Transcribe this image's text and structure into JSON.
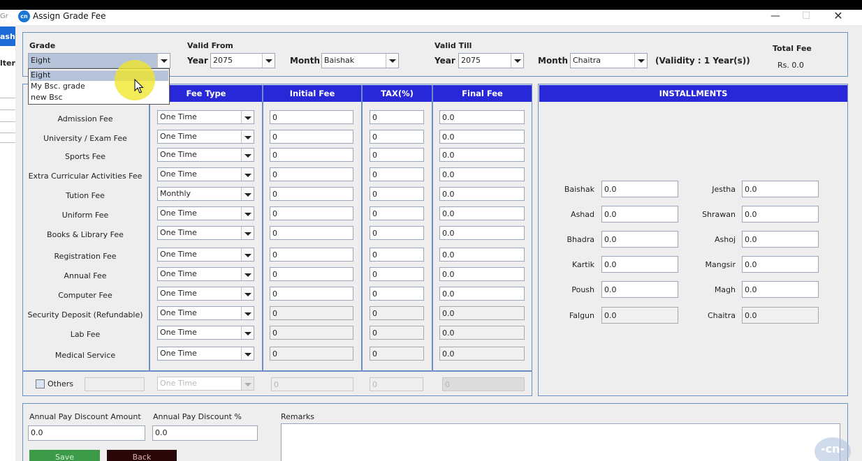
{
  "background_app": {
    "title_fragment": "Gr",
    "nav_fragment": "ashb",
    "filter_fragment": "lter"
  },
  "window": {
    "title": "Assign Grade Fee",
    "logo_text": "cn",
    "minimize_glyph": "—",
    "maximize_glyph": "☐",
    "close_glyph": "✕"
  },
  "header": {
    "grade_label": "Grade",
    "grade_value": "Eight",
    "grade_options": [
      "Eight",
      "My Bsc. grade",
      "new Bsc"
    ],
    "valid_from_label": "Valid From",
    "valid_from_year_label": "Year",
    "valid_from_year": "2075",
    "valid_from_month_label": "Month",
    "valid_from_month": "Baishak",
    "valid_till_label": "Valid Till",
    "valid_till_year_label": "Year",
    "valid_till_year": "2075",
    "valid_till_month_label": "Month",
    "valid_till_month": "Chaitra",
    "validity_text": "(Validity : 1 Year(s))",
    "total_fee_label": "Total Fee",
    "total_fee_value": "Rs. 0.0"
  },
  "fee_table": {
    "columns": [
      "Fee Type",
      "Initial Fee",
      "TAX(%)",
      "Final Fee"
    ],
    "rows": [
      {
        "name": "Admission Fee",
        "type": "One Time",
        "initial": "0",
        "tax": "0",
        "final": "0.0"
      },
      {
        "name": "University / Exam Fee",
        "type": "One Time",
        "initial": "0",
        "tax": "0",
        "final": "0.0"
      },
      {
        "name": "Sports Fee",
        "type": "One Time",
        "initial": "0",
        "tax": "0",
        "final": "0.0"
      },
      {
        "name": "Extra Curricular Activities Fee",
        "type": "One Time",
        "initial": "0",
        "tax": "0",
        "final": "0.0"
      },
      {
        "name": "Tution Fee",
        "type": "Monthly",
        "initial": "0",
        "tax": "0",
        "final": "0.0"
      },
      {
        "name": "Uniform Fee",
        "type": "One Time",
        "initial": "0",
        "tax": "0",
        "final": "0.0"
      },
      {
        "name": "Books & Library Fee",
        "type": "One Time",
        "initial": "0",
        "tax": "0",
        "final": "0.0"
      },
      {
        "name": "Registration Fee",
        "type": "One Time",
        "initial": "0",
        "tax": "0",
        "final": "0.0"
      },
      {
        "name": "Annual Fee",
        "type": "One Time",
        "initial": "0",
        "tax": "0",
        "final": "0.0"
      },
      {
        "name": "Computer Fee",
        "type": "One Time",
        "initial": "0",
        "tax": "0",
        "final": "0.0"
      },
      {
        "name": "Security Deposit (Refundable)",
        "type": "One Time",
        "initial": "0",
        "tax": "0",
        "final": "0.0"
      },
      {
        "name": "Lab Fee",
        "type": "One Time",
        "initial": "0",
        "tax": "0",
        "final": "0.0"
      },
      {
        "name": "Medical Service",
        "type": "One Time",
        "initial": "0",
        "tax": "0",
        "final": "0.0"
      }
    ],
    "others": {
      "label": "Others",
      "type": "One Time",
      "initial": "0",
      "tax": "0",
      "final": "0"
    }
  },
  "installments": {
    "title": "INSTALLMENTS",
    "months": [
      {
        "name": "Baishak",
        "value": "0.0"
      },
      {
        "name": "Jestha",
        "value": "0.0"
      },
      {
        "name": "Ashad",
        "value": "0.0"
      },
      {
        "name": "Shrawan",
        "value": "0.0"
      },
      {
        "name": "Bhadra",
        "value": "0.0"
      },
      {
        "name": "Ashoj",
        "value": "0.0"
      },
      {
        "name": "Kartik",
        "value": "0.0"
      },
      {
        "name": "Mangsir",
        "value": "0.0"
      },
      {
        "name": "Poush",
        "value": "0.0"
      },
      {
        "name": "Magh",
        "value": "0.0"
      },
      {
        "name": "Falgun",
        "value": "0.0"
      },
      {
        "name": "Chaitra",
        "value": "0.0"
      }
    ]
  },
  "footer": {
    "discount_amount_label": "Annual Pay Discount Amount",
    "discount_amount_value": "0.0",
    "discount_percent_label": "Annual Pay Discount %",
    "discount_percent_value": "0.0",
    "remarks_label": "Remarks",
    "save_label": "Save",
    "back_label": "Back"
  },
  "watermark_text": "-cn-",
  "colors": {
    "header_blue": "#2828d8",
    "panel_border": "#6c8fc6",
    "save_green": "#3c9a48",
    "back_dark": "#2a0808",
    "cursor_highlight": "#f0e628"
  }
}
